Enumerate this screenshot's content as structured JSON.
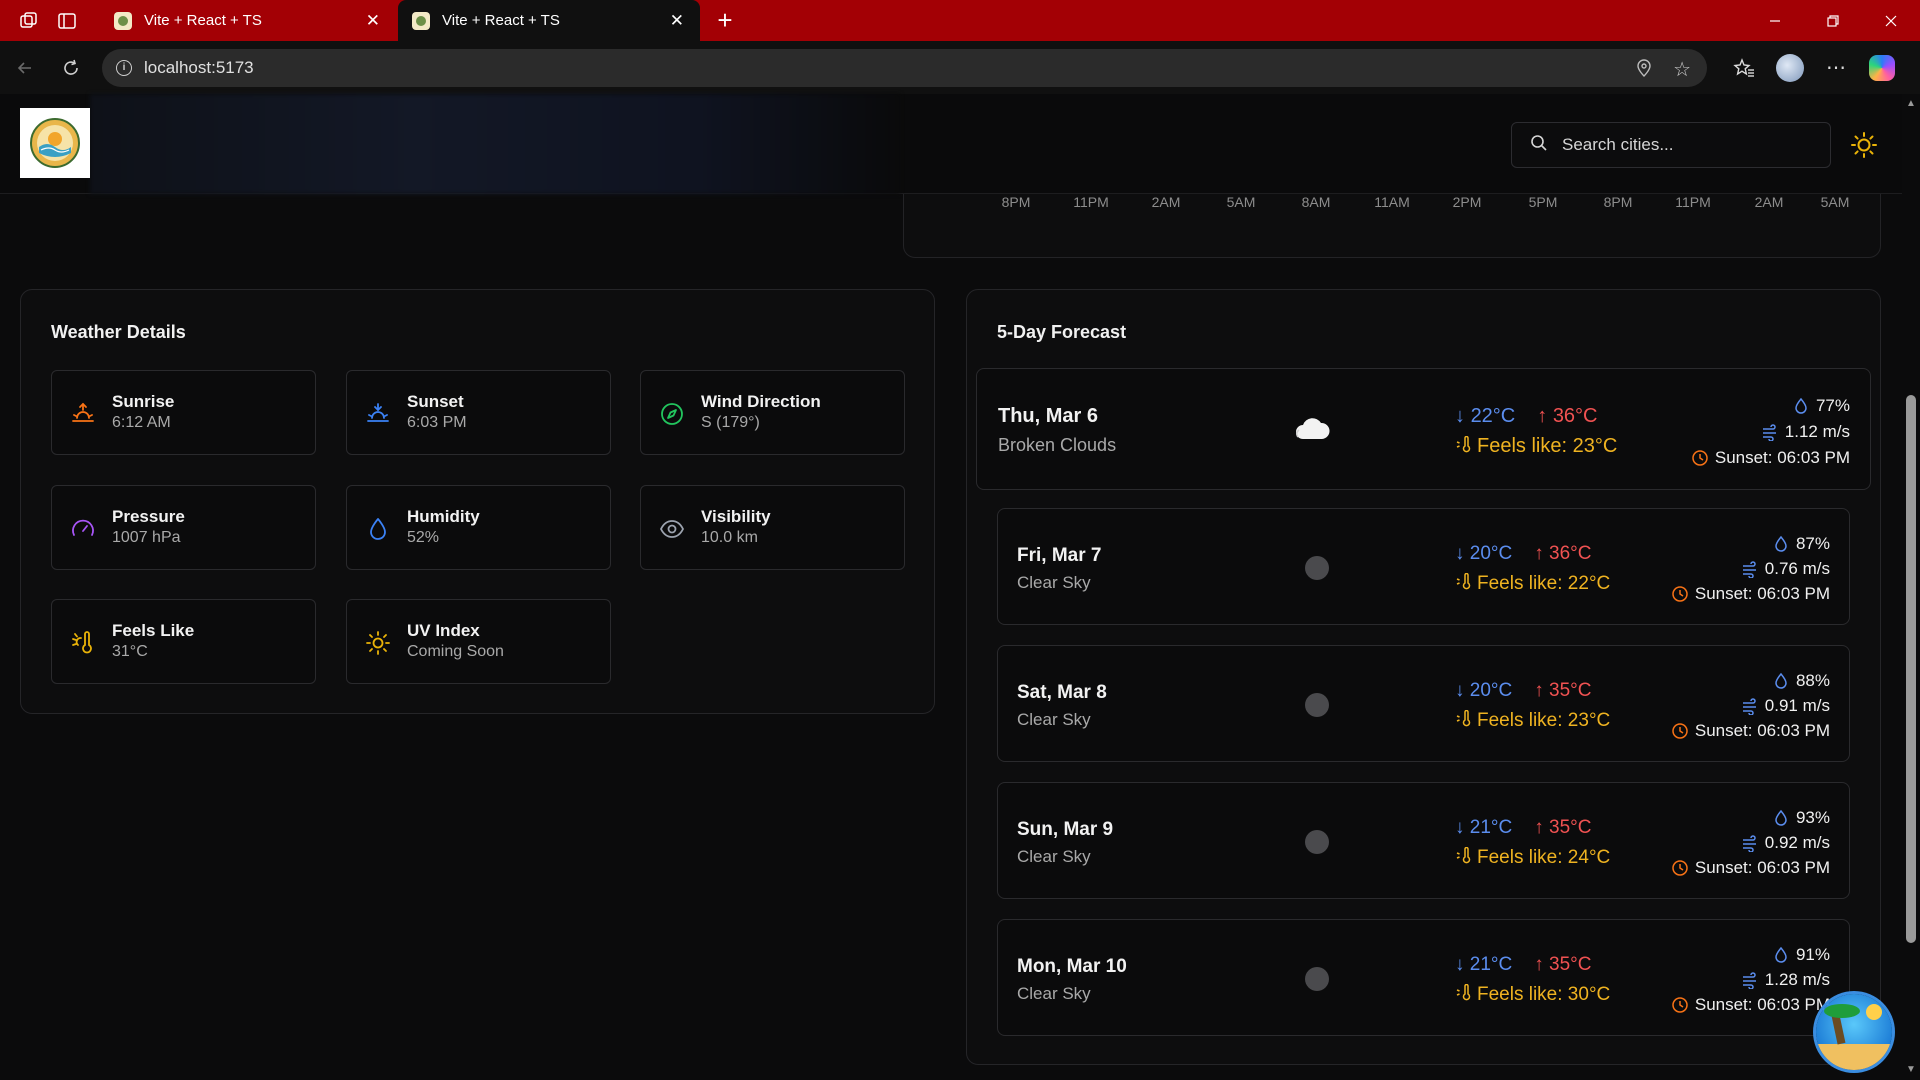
{
  "browser": {
    "tabs": [
      {
        "title": "Vite + React + TS",
        "active": false
      },
      {
        "title": "Vite + React + TS",
        "active": true
      }
    ],
    "url": "localhost:5173"
  },
  "header": {
    "search_placeholder": "Search cities..."
  },
  "hourly_axis": {
    "ticks": [
      "8PM",
      "11PM",
      "2AM",
      "5AM",
      "8AM",
      "11AM",
      "2PM",
      "5PM",
      "8PM",
      "11PM",
      "2AM",
      "5AM"
    ]
  },
  "weather_details": {
    "title": "Weather Details",
    "items": [
      {
        "label": "Sunrise",
        "value": "6:12 AM",
        "icon": "sunrise-icon",
        "color": "#f97316"
      },
      {
        "label": "Sunset",
        "value": "6:03 PM",
        "icon": "sunset-icon",
        "color": "#3b82f6"
      },
      {
        "label": "Wind Direction",
        "value": "S (179°)",
        "icon": "compass-icon",
        "color": "#22c55e"
      },
      {
        "label": "Pressure",
        "value": "1007 hPa",
        "icon": "gauge-icon",
        "color": "#a855f7"
      },
      {
        "label": "Humidity",
        "value": "52%",
        "icon": "droplet-icon",
        "color": "#3b82f6"
      },
      {
        "label": "Visibility",
        "value": "10.0 km",
        "icon": "eye-icon",
        "color": "#9ca3af"
      },
      {
        "label": "Feels Like",
        "value": "31°C",
        "icon": "thermometer-sun-icon",
        "color": "#eab308"
      },
      {
        "label": "UV Index",
        "value": "Coming Soon",
        "icon": "sun-icon",
        "color": "#eab308"
      }
    ]
  },
  "forecast": {
    "title": "5-Day Forecast",
    "days": [
      {
        "date": "Thu, Mar 6",
        "desc": "Broken Clouds",
        "icon": "cloud-icon",
        "min": "22°C",
        "max": "36°C",
        "feels": "Feels like: 23°C",
        "humidity": "77%",
        "wind": "1.12 m/s",
        "sunset": "Sunset: 06:03 PM"
      },
      {
        "date": "Fri, Mar 7",
        "desc": "Clear Sky",
        "icon": "clear-sky-icon",
        "min": "20°C",
        "max": "36°C",
        "feels": "Feels like: 22°C",
        "humidity": "87%",
        "wind": "0.76 m/s",
        "sunset": "Sunset: 06:03 PM"
      },
      {
        "date": "Sat, Mar 8",
        "desc": "Clear Sky",
        "icon": "clear-sky-icon",
        "min": "20°C",
        "max": "35°C",
        "feels": "Feels like: 23°C",
        "humidity": "88%",
        "wind": "0.91 m/s",
        "sunset": "Sunset: 06:03 PM"
      },
      {
        "date": "Sun, Mar 9",
        "desc": "Clear Sky",
        "icon": "clear-sky-icon",
        "min": "21°C",
        "max": "35°C",
        "feels": "Feels like: 24°C",
        "humidity": "93%",
        "wind": "0.92 m/s",
        "sunset": "Sunset: 06:03 PM"
      },
      {
        "date": "Mon, Mar 10",
        "desc": "Clear Sky",
        "icon": "clear-sky-icon",
        "min": "21°C",
        "max": "35°C",
        "feels": "Feels like: 30°C",
        "humidity": "91%",
        "wind": "1.28 m/s",
        "sunset": "Sunset: 06:03 PM"
      }
    ]
  },
  "colors": {
    "min_temp": "#5b8dee",
    "max_temp": "#f05252",
    "feels": "#efb321",
    "sunset_clock": "#f97316"
  }
}
